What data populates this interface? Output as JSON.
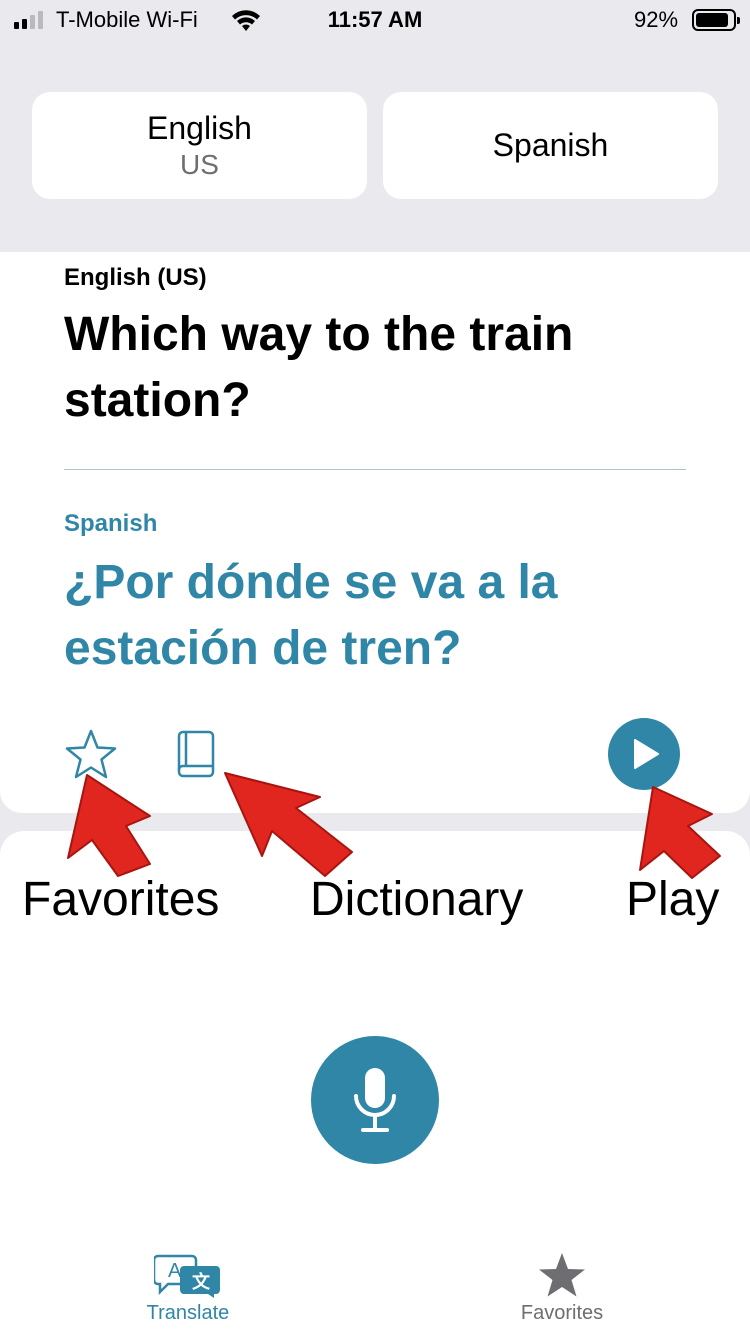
{
  "status_bar": {
    "carrier": "T-Mobile Wi-Fi",
    "time": "11:57 AM",
    "battery_percent": "92%",
    "battery_level": 0.92,
    "signal_bars": 4,
    "signal_bars_active": 2
  },
  "language_picker": {
    "source": {
      "name": "English",
      "region": "US"
    },
    "target": {
      "name": "Spanish"
    }
  },
  "translation": {
    "source_label": "English (US)",
    "source_text": "Which way to the train station?",
    "target_label": "Spanish",
    "target_text": "¿Por dónde se va a la estación de tren?"
  },
  "actions": {
    "favorite_icon": "star-outline-icon",
    "dictionary_icon": "book-icon",
    "play_icon": "play-icon"
  },
  "annotations": {
    "favorites": "Favorites",
    "dictionary": "Dictionary",
    "play": "Play"
  },
  "microphone": {
    "icon": "microphone-icon"
  },
  "tab_bar": {
    "translate_label": "Translate",
    "favorites_label": "Favorites"
  },
  "colors": {
    "accent": "#2f86a6",
    "background": "#e9e9ee",
    "annotation_arrow": "#e0261f"
  }
}
